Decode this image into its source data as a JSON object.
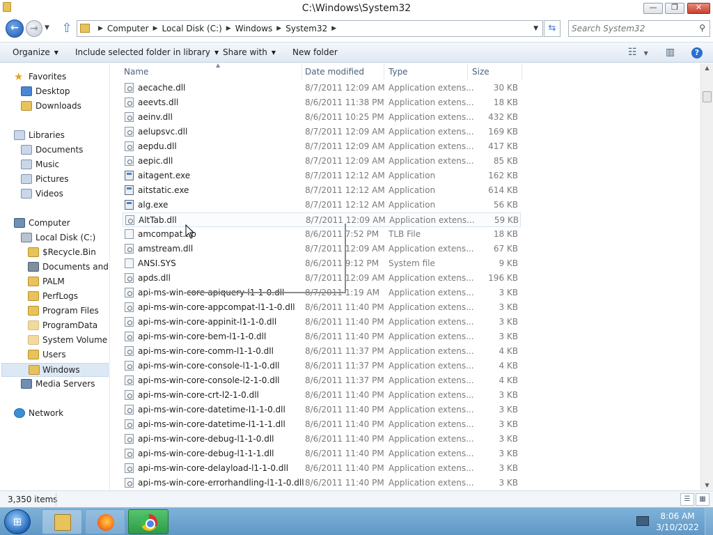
{
  "window": {
    "title": "C:\\Windows\\System32"
  },
  "window_controls": {
    "minimize": "—",
    "maximize": "❐",
    "close": "✕"
  },
  "address": {
    "crumbs": [
      "Computer",
      "Local Disk (C:)",
      "Windows",
      "System32"
    ]
  },
  "search": {
    "placeholder": "Search System32"
  },
  "toolbar": {
    "organize": "Organize",
    "include": "Include selected folder in library",
    "share": "Share with",
    "new_folder": "New folder"
  },
  "nav": {
    "favorites": "Favorites",
    "desktop": "Desktop",
    "downloads": "Downloads",
    "libraries": "Libraries",
    "documents": "Documents",
    "music": "Music",
    "pictures": "Pictures",
    "videos": "Videos",
    "computer": "Computer",
    "local_disk": "Local Disk (C:)",
    "recycle": "$Recycle.Bin",
    "docs_settings": "Documents and Settings",
    "palm": "PALM",
    "perflogs": "PerfLogs",
    "program_files": "Program Files",
    "program_data": "ProgramData",
    "svi": "System Volume Information",
    "users": "Users",
    "windows": "Windows",
    "media_servers": "Media Servers",
    "network": "Network"
  },
  "columns": {
    "name": "Name",
    "date": "Date modified",
    "type": "Type",
    "size": "Size"
  },
  "files": [
    {
      "name": "aecache.dll",
      "date": "8/7/2011 12:09 AM",
      "type": "Application extens...",
      "size": "30 KB",
      "kind": "dll"
    },
    {
      "name": "aeevts.dll",
      "date": "8/6/2011 11:38 PM",
      "type": "Application extens...",
      "size": "18 KB",
      "kind": "dll"
    },
    {
      "name": "aeinv.dll",
      "date": "8/6/2011 10:25 PM",
      "type": "Application extens...",
      "size": "432 KB",
      "kind": "dll"
    },
    {
      "name": "aelupsvc.dll",
      "date": "8/7/2011 12:09 AM",
      "type": "Application extens...",
      "size": "169 KB",
      "kind": "dll"
    },
    {
      "name": "aepdu.dll",
      "date": "8/7/2011 12:09 AM",
      "type": "Application extens...",
      "size": "417 KB",
      "kind": "dll"
    },
    {
      "name": "aepic.dll",
      "date": "8/7/2011 12:09 AM",
      "type": "Application extens...",
      "size": "85 KB",
      "kind": "dll"
    },
    {
      "name": "aitagent.exe",
      "date": "8/7/2011 12:12 AM",
      "type": "Application",
      "size": "162 KB",
      "kind": "exe"
    },
    {
      "name": "aitstatic.exe",
      "date": "8/7/2011 12:12 AM",
      "type": "Application",
      "size": "614 KB",
      "kind": "exe"
    },
    {
      "name": "alg.exe",
      "date": "8/7/2011 12:12 AM",
      "type": "Application",
      "size": "56 KB",
      "kind": "exe"
    },
    {
      "name": "AltTab.dll",
      "date": "8/7/2011 12:09 AM",
      "type": "Application extens...",
      "size": "59 KB",
      "kind": "dll"
    },
    {
      "name": "amcompat.tlb",
      "date": "8/6/2011 7:52 PM",
      "type": "TLB File",
      "size": "18 KB",
      "kind": "file"
    },
    {
      "name": "amstream.dll",
      "date": "8/7/2011 12:09 AM",
      "type": "Application extens...",
      "size": "67 KB",
      "kind": "dll"
    },
    {
      "name": "ANSI.SYS",
      "date": "8/6/2011 9:12 PM",
      "type": "System file",
      "size": "9 KB",
      "kind": "file"
    },
    {
      "name": "apds.dll",
      "date": "8/7/2011 12:09 AM",
      "type": "Application extens...",
      "size": "196 KB",
      "kind": "dll"
    },
    {
      "name": "api-ms-win-core-apiquery-l1-1-0.dll",
      "date": "8/7/2011 1:19 AM",
      "type": "Application extens...",
      "size": "3 KB",
      "kind": "dll"
    },
    {
      "name": "api-ms-win-core-appcompat-l1-1-0.dll",
      "date": "8/6/2011 11:40 PM",
      "type": "Application extens...",
      "size": "3 KB",
      "kind": "dll"
    },
    {
      "name": "api-ms-win-core-appinit-l1-1-0.dll",
      "date": "8/6/2011 11:40 PM",
      "type": "Application extens...",
      "size": "3 KB",
      "kind": "dll"
    },
    {
      "name": "api-ms-win-core-bem-l1-1-0.dll",
      "date": "8/6/2011 11:40 PM",
      "type": "Application extens...",
      "size": "3 KB",
      "kind": "dll"
    },
    {
      "name": "api-ms-win-core-comm-l1-1-0.dll",
      "date": "8/6/2011 11:37 PM",
      "type": "Application extens...",
      "size": "4 KB",
      "kind": "dll"
    },
    {
      "name": "api-ms-win-core-console-l1-1-0.dll",
      "date": "8/6/2011 11:37 PM",
      "type": "Application extens...",
      "size": "4 KB",
      "kind": "dll"
    },
    {
      "name": "api-ms-win-core-console-l2-1-0.dll",
      "date": "8/6/2011 11:37 PM",
      "type": "Application extens...",
      "size": "4 KB",
      "kind": "dll"
    },
    {
      "name": "api-ms-win-core-crt-l2-1-0.dll",
      "date": "8/6/2011 11:40 PM",
      "type": "Application extens...",
      "size": "3 KB",
      "kind": "dll"
    },
    {
      "name": "api-ms-win-core-datetime-l1-1-0.dll",
      "date": "8/6/2011 11:40 PM",
      "type": "Application extens...",
      "size": "3 KB",
      "kind": "dll"
    },
    {
      "name": "api-ms-win-core-datetime-l1-1-1.dll",
      "date": "8/6/2011 11:40 PM",
      "type": "Application extens...",
      "size": "3 KB",
      "kind": "dll"
    },
    {
      "name": "api-ms-win-core-debug-l1-1-0.dll",
      "date": "8/6/2011 11:40 PM",
      "type": "Application extens...",
      "size": "3 KB",
      "kind": "dll"
    },
    {
      "name": "api-ms-win-core-debug-l1-1-1.dll",
      "date": "8/6/2011 11:40 PM",
      "type": "Application extens...",
      "size": "3 KB",
      "kind": "dll"
    },
    {
      "name": "api-ms-win-core-delayload-l1-1-0.dll",
      "date": "8/6/2011 11:40 PM",
      "type": "Application extens...",
      "size": "3 KB",
      "kind": "dll"
    },
    {
      "name": "api-ms-win-core-errorhandling-l1-1-0.dll",
      "date": "8/6/2011 11:40 PM",
      "type": "Application extens...",
      "size": "3 KB",
      "kind": "dll"
    }
  ],
  "status": {
    "count": "3,350 items"
  },
  "taskbar": {
    "time": "8:06 AM",
    "date": "3/10/2022"
  },
  "icons": {
    "back": "arrow-left-icon",
    "forward": "arrow-right-icon",
    "up": "arrow-up-icon",
    "refresh": "refresh-icon",
    "search": "magnifier-icon",
    "help": "help-icon"
  },
  "colors": {
    "accent": "#1d5bb5",
    "selection": "#dde8f5",
    "taskbar": "#6fa5cf",
    "chrome_active": "#2e9a47"
  }
}
